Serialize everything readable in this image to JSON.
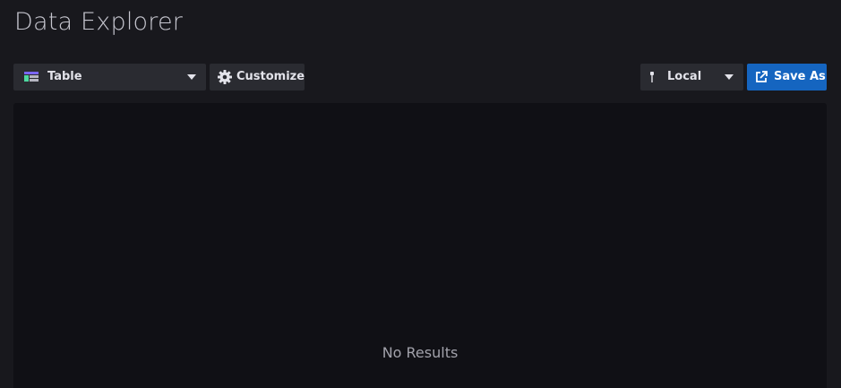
{
  "header": {
    "title": "Data Explorer"
  },
  "toolbar": {
    "visualization": {
      "selected": "Table",
      "icon": "table-icon"
    },
    "customize": {
      "label": "Customize",
      "icon": "gear-icon"
    },
    "timezone": {
      "selected": "Local",
      "icon": "pin-icon"
    },
    "save_as": {
      "label": "Save As",
      "icon": "export-icon"
    }
  },
  "results": {
    "empty_message": "No Results"
  },
  "colors": {
    "background": "#18181d",
    "panel": "#101015",
    "control": "#2a2b31",
    "primary": "#1565c0",
    "text": "#e3e3ea",
    "muted": "#a2a2ab"
  }
}
